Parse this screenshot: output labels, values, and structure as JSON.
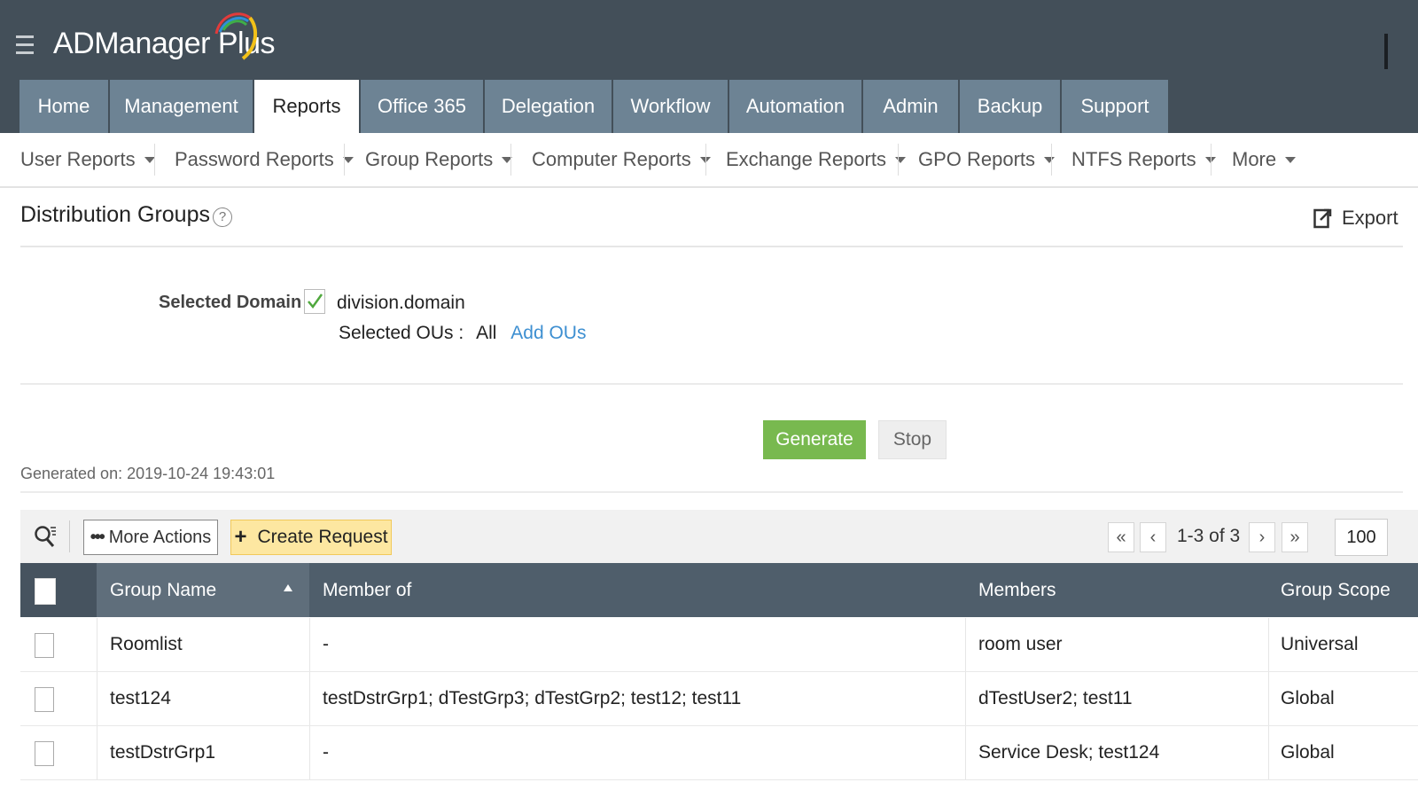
{
  "app": {
    "name": "ADManager Plus"
  },
  "tabs": [
    {
      "label": "Home"
    },
    {
      "label": "Management"
    },
    {
      "label": "Reports"
    },
    {
      "label": "Office 365"
    },
    {
      "label": "Delegation"
    },
    {
      "label": "Workflow"
    },
    {
      "label": "Automation"
    },
    {
      "label": "Admin"
    },
    {
      "label": "Backup"
    },
    {
      "label": "Support"
    }
  ],
  "active_tab": "Reports",
  "subnav": [
    {
      "label": "User Reports"
    },
    {
      "label": "Password Reports"
    },
    {
      "label": "Group Reports"
    },
    {
      "label": "Computer Reports"
    },
    {
      "label": "Exchange Reports"
    },
    {
      "label": "GPO Reports"
    },
    {
      "label": "NTFS Reports"
    },
    {
      "label": "More"
    }
  ],
  "page": {
    "title": "Distribution Groups",
    "help": "?",
    "export_label": "Export"
  },
  "filters": {
    "domain_label": "Selected Domain",
    "domain_checked": true,
    "domain_name": "division.domain",
    "ous_label": "Selected OUs :",
    "ous_value": "All",
    "add_ous_label": "Add OUs"
  },
  "actions": {
    "generate_label": "Generate",
    "stop_label": "Stop"
  },
  "generated_on": "Generated on: 2019-10-24 19:43:01",
  "toolbar": {
    "more_actions_label": "More Actions",
    "more_actions_prefix": "•••",
    "create_request_label": "Create Request",
    "create_request_prefix": "+",
    "first_page": "«",
    "prev_page": "‹",
    "page_range": "1-3 of 3",
    "next_page": "›",
    "last_page": "»",
    "page_size": "100"
  },
  "table": {
    "columns": [
      "Group Name",
      "Member of",
      "Members",
      "Group Scope"
    ],
    "sorted_column": "Group Name",
    "sort_direction": "ascending",
    "rows": [
      {
        "group_name": "Roomlist",
        "member_of": "-",
        "members": "room user",
        "group_scope": "Universal"
      },
      {
        "group_name": "test124",
        "member_of": "testDstrGrp1; dTestGrp3; dTestGrp2; test12; test11",
        "members": "dTestUser2; test11",
        "group_scope": "Global"
      },
      {
        "group_name": "testDstrGrp1",
        "member_of": "-",
        "members": "Service Desk; test124",
        "group_scope": "Global"
      }
    ]
  },
  "colors": {
    "topbar": "#434f59",
    "tab": "#6d8394",
    "table_header": "#4f5e6b",
    "generate": "#78b94f",
    "create_request": "#fde7a1",
    "link": "#3d8fd1"
  }
}
